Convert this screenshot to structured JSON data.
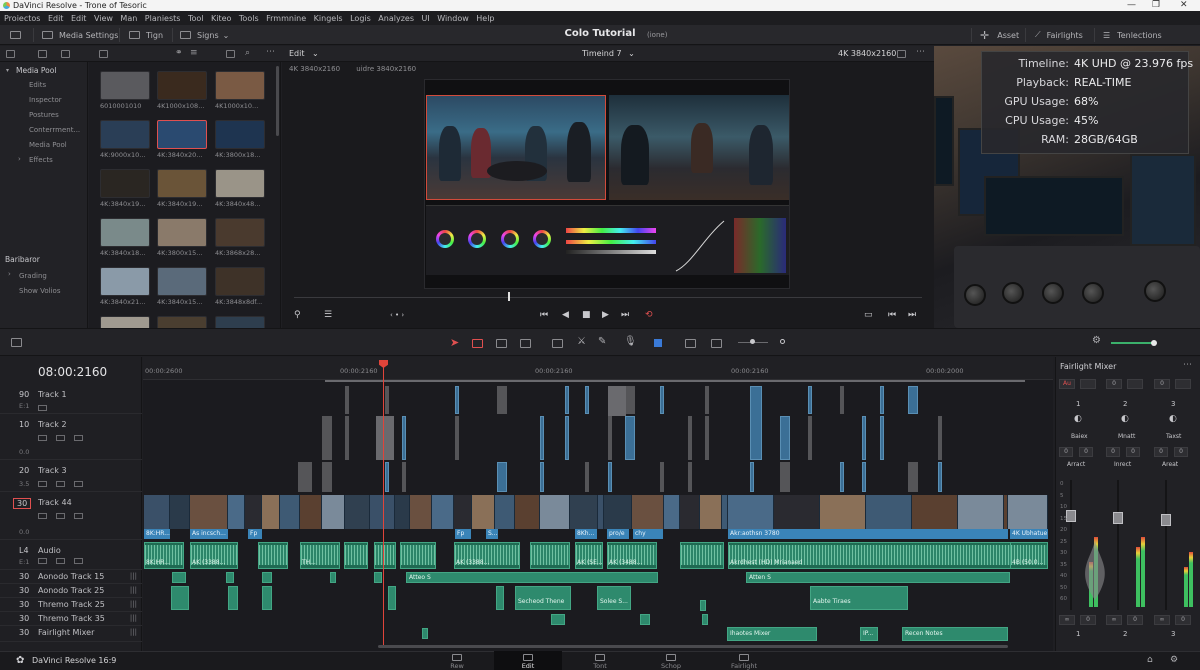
{
  "window": {
    "title": "DaVinci Resolve - Trone of Tesoric",
    "controls": [
      "—",
      "❐",
      "✕"
    ]
  },
  "menu": [
    "Proiectos",
    "Edit",
    "Edit",
    "View",
    "Man",
    "Planiests",
    "Tool",
    "Kiteo",
    "Tools",
    "Frmmnine",
    "Kingels",
    "Logis",
    "Analyzes",
    "UI",
    "Window",
    "Help"
  ],
  "toolbar": {
    "media_settings": "Media Settings",
    "tign": "Tign",
    "signs": "Signs",
    "project_title": "Colo Tutorial",
    "project_status": "(ione)",
    "asset": "Asset",
    "fairlights": "Fairlights",
    "tenlections": "Tenlections"
  },
  "subbar": {
    "edit_mode": "Edit",
    "timeline_name": "Timeind 7",
    "resolution": "4K 3840x2160"
  },
  "sidebar": {
    "media_pool": "Media Pool",
    "items": [
      "Edits",
      "Inspector",
      "Postures",
      "Conterrment...",
      "Media Pool",
      "Effects"
    ],
    "section2_title": "Baribaror",
    "section2_items": [
      "Grading",
      "Show Volios"
    ]
  },
  "mediapool": {
    "thumbs": [
      {
        "label": "6010001010",
        "color": "#5a5a5e"
      },
      {
        "label": "4K1000x108...",
        "color": "#3a2a1e"
      },
      {
        "label": "4K1000x10...",
        "color": "#7a5a44"
      },
      {
        "label": "4K:9000x10...",
        "color": "#2a3e56"
      },
      {
        "label": "4K:3840x20...",
        "color": "#2a4a70"
      },
      {
        "label": "4K:3800x18...",
        "color": "#1e3450"
      },
      {
        "label": "4K:3840x19...",
        "color": "#2a2622"
      },
      {
        "label": "4K:3840x19...",
        "color": "#6a5438"
      },
      {
        "label": "4K:3840x48...",
        "color": "#9a9488"
      },
      {
        "label": "4K:3840x18...",
        "color": "#7a8a8a"
      },
      {
        "label": "4K:3800x15...",
        "color": "#8a7a6a"
      },
      {
        "label": "4K:3868x28...",
        "color": "#4a3a2e"
      },
      {
        "label": "4K:3840x21...",
        "color": "#8a9aa8"
      },
      {
        "label": "4K:3840x15...",
        "color": "#5a6a7a"
      },
      {
        "label": "4K:3848x8df...",
        "color": "#3e3228"
      },
      {
        "label": "",
        "color": "#a09a90"
      },
      {
        "label": "",
        "color": "#4a3e30"
      },
      {
        "label": "",
        "color": "#2e3e4e"
      }
    ]
  },
  "viewer": {
    "res_a": "4K   3840x2160",
    "res_b": "uidre  3840x2160"
  },
  "stats": [
    {
      "key": "Timeline:",
      "value": "4K UHD @ 23.976 fps"
    },
    {
      "key": "Playback:",
      "value": "REAL-TIME"
    },
    {
      "key": "GPU Usage:",
      "value": "68%"
    },
    {
      "key": "CPU Usage:",
      "value": "45%"
    },
    {
      "key": "RAM:",
      "value": "28GB/64GB"
    }
  ],
  "timeline": {
    "timecode": "08:00:2160",
    "ruler": [
      "00:00:2600",
      "00:00:2160",
      "00:00:2160",
      "00:00:2160",
      "00:00:2000"
    ],
    "tracks": [
      {
        "num": "90",
        "name": "Track 1"
      },
      {
        "num": "10",
        "name": "Track 2"
      },
      {
        "num": "20",
        "name": "Track 3"
      },
      {
        "num": "30",
        "name": "Track 44"
      },
      {
        "num": "L4",
        "name": "Audio"
      },
      {
        "num": "30",
        "name": "Aonodo Track 15"
      },
      {
        "num": "30",
        "name": "Aonodo Track 25"
      },
      {
        "num": "30",
        "name": "Thremo Track 25"
      },
      {
        "num": "30",
        "name": "Thremo Track 35"
      },
      {
        "num": "30",
        "name": "Fairlight Mixer"
      }
    ],
    "sub_values": [
      "E:1",
      "0.0",
      "3.5",
      "0.0",
      "E:1"
    ],
    "video_labels": [
      "8K:HR...",
      "As incsch...",
      "Fp",
      "Fp",
      "S...",
      "8Kh...",
      "pro/e",
      "chy",
      "Akr:aothsn 3780",
      "4K Ubhatue"
    ],
    "audio_labels": [
      "8K:HR...",
      "AK (3388...",
      "TH...",
      "AK (3388...",
      "AK (SE...",
      "AK (3488...",
      "Akrdhest (HD) Mrianaed",
      "4B (50.0..."
    ],
    "aclips": [
      "Atteo S",
      "Atten S",
      "Secheod Thene",
      "Solee S...",
      "Aabte Tiraes",
      "Ihaotes Mixer",
      "IP...",
      "Recen Notes"
    ]
  },
  "mixer": {
    "title": "Fairlight Mixer",
    "channels": [
      {
        "num": "1",
        "name": "Baiex",
        "mode": "Arract"
      },
      {
        "num": "2",
        "name": "Mnatt",
        "mode": "Inrect"
      },
      {
        "num": "3",
        "name": "Taxst",
        "mode": "Areat"
      }
    ],
    "au": "Au",
    "zero": "0",
    "inf": "∞",
    "scale": [
      "0",
      "5",
      "10",
      "15",
      "20",
      "25",
      "30",
      "35",
      "40",
      "50",
      "60"
    ]
  },
  "pages": {
    "app_name": "DaVinci Resolve 16:9",
    "tabs": [
      "Rew",
      "Edit",
      "Tont",
      "Schop",
      "Fairlight"
    ]
  }
}
